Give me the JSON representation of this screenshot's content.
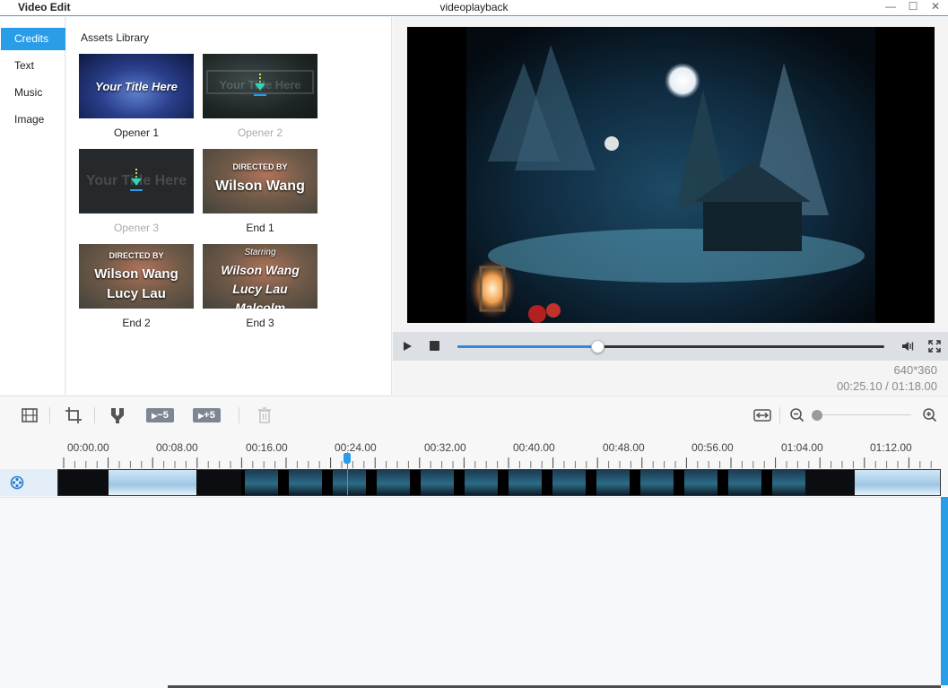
{
  "window": {
    "app_title": "Video Edit",
    "file_title": "videoplayback",
    "minimize_label": "—",
    "maximize_label": "☐",
    "close_label": "✕"
  },
  "sidebar": {
    "items": [
      {
        "label": "Credits",
        "active": true
      },
      {
        "label": "Text",
        "active": false
      },
      {
        "label": "Music",
        "active": false
      },
      {
        "label": "Image",
        "active": false
      }
    ]
  },
  "assets": {
    "title": "Assets Library",
    "items": [
      {
        "caption": "Opener 1",
        "lines": [
          "Your Title Here"
        ],
        "downloaded": true
      },
      {
        "caption": "Opener 2",
        "lines": [
          "Your Title Here"
        ],
        "downloaded": false
      },
      {
        "caption": "Opener 3",
        "lines": [
          "Your Title Here"
        ],
        "downloaded": false
      },
      {
        "caption": "End 1",
        "lines": [
          "DIRECTED BY",
          "Wilson Wang"
        ],
        "downloaded": true
      },
      {
        "caption": "End 2",
        "lines": [
          "DIRECTED BY",
          "Wilson Wang",
          "Lucy Lau"
        ],
        "downloaded": true
      },
      {
        "caption": "End 3",
        "lines": [
          "Starring",
          "Wilson Wang",
          "Lucy Lau",
          "Malcolm"
        ],
        "downloaded": true
      }
    ]
  },
  "player": {
    "resolution": "640*360",
    "timecode": "00:25.10 / 01:18.00",
    "progress": 0.327
  },
  "toolbar": {
    "skip_back_label": "−5",
    "skip_forward_label": "+5"
  },
  "timeline": {
    "ruler_labels": [
      "00:00.00",
      "00:08.00",
      "00:16.00",
      "00:24.00",
      "00:32.00",
      "00:40.00",
      "00:48.00",
      "00:56.00",
      "01:04.00",
      "01:12.00"
    ]
  },
  "colors": {
    "accent": "#2a9de9",
    "skip_button": "#7d8794"
  },
  "icons": {
    "track": "film-reel-icon",
    "play": "play-icon",
    "stop": "stop-icon",
    "volume": "volume-icon",
    "fullscreen": "fullscreen-icon"
  }
}
